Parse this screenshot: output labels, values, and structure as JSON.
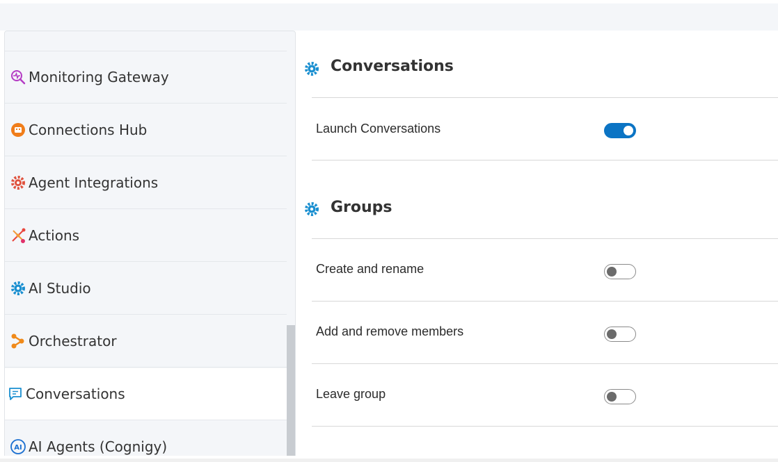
{
  "sidebar": {
    "items": [
      {
        "label": "Monitoring Gateway",
        "icon": "monitoring-gateway-icon"
      },
      {
        "label": "Connections Hub",
        "icon": "connections-hub-icon"
      },
      {
        "label": "Agent Integrations",
        "icon": "agent-integrations-icon"
      },
      {
        "label": "Actions",
        "icon": "actions-icon"
      },
      {
        "label": "AI Studio",
        "icon": "ai-studio-icon"
      },
      {
        "label": "Orchestrator",
        "icon": "orchestrator-icon"
      },
      {
        "label": "Conversations",
        "icon": "conversations-icon",
        "active": true
      },
      {
        "label": "AI Agents (Cognigy)",
        "icon": "ai-agents-icon"
      }
    ]
  },
  "main": {
    "sections": [
      {
        "title": "Conversations",
        "rows": [
          {
            "label": "Launch Conversations",
            "enabled": true
          }
        ]
      },
      {
        "title": "Groups",
        "rows": [
          {
            "label": "Create and rename",
            "enabled": false
          },
          {
            "label": "Add and remove members",
            "enabled": false
          },
          {
            "label": "Leave group",
            "enabled": false
          }
        ]
      }
    ]
  },
  "colors": {
    "accent": "#0b74c4",
    "sidebar_bg": "#f4f6f9",
    "gear_icon": "#1a8fd0"
  }
}
